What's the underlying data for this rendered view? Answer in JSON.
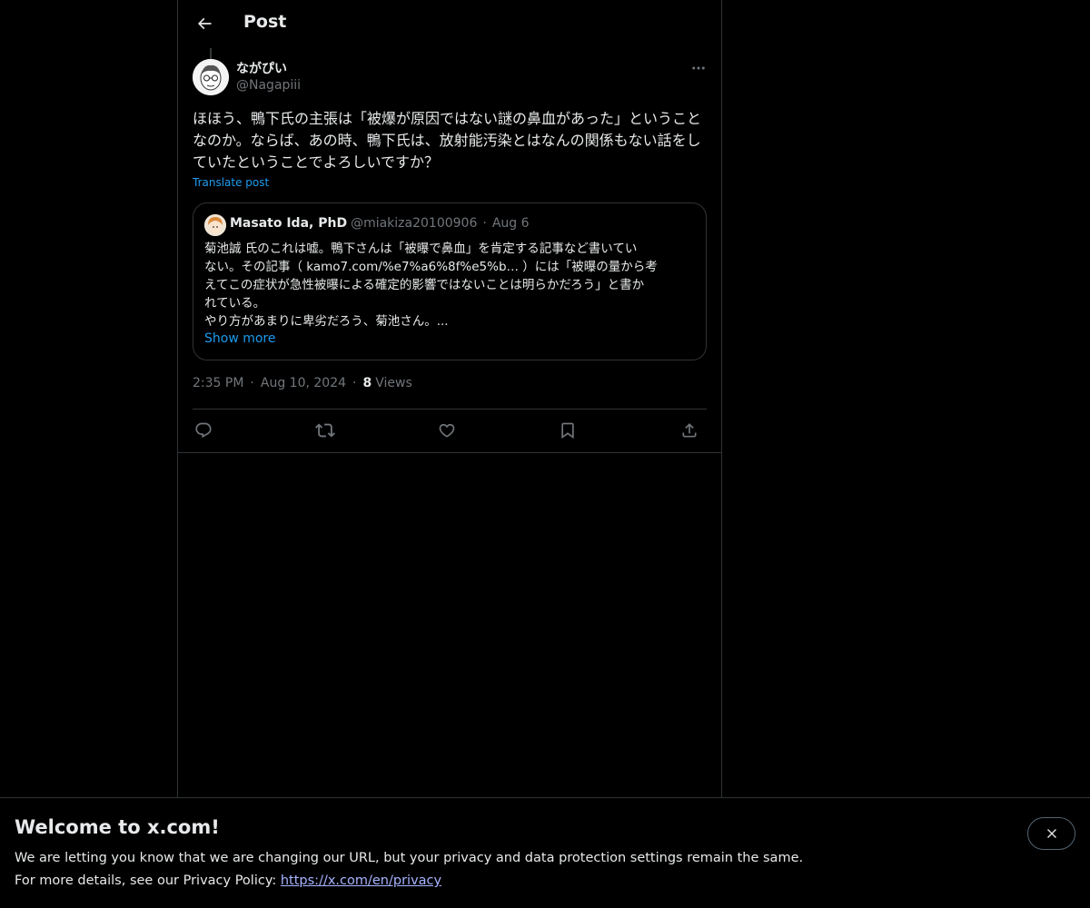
{
  "header": {
    "title": "Post"
  },
  "post": {
    "author_name": "ながぴい",
    "author_handle": "@Nagapiii",
    "text": "ほほう、鴨下氏の主張は「被爆が原因ではない謎の鼻血があった」ということなのか。ならば、あの時、鴨下氏は、放射能汚染とはなんの関係もない話をしていたということでよろしいですか？",
    "translate_label": "Translate post",
    "time": "2:35 PM",
    "date": "Aug 10, 2024",
    "views_count": "8",
    "views_label": "Views",
    "separator": "·"
  },
  "quote": {
    "name": "Masato Ida, PhD",
    "handle": "@miakiza20100906",
    "separator": "·",
    "date": "Aug 6",
    "text_lines": [
      "菊池誠 氏のこれは嘘。鴨下さんは「被曝で鼻血」を肯定する記事など書いてい",
      "ない。その記事（ kamo7.com/%e7%a6%8f%e5%b… ）には「被曝の量から考",
      "えてこの症状が急性被曝による確定的影響ではないことは明らかだろう」と書か",
      "れている。",
      "やり方があまりに卑劣だろう、菊池さん。..."
    ],
    "show_more": "Show more"
  },
  "banner": {
    "title": "Welcome to x.com!",
    "line1": "We are letting you know that we are changing our URL, but your privacy and data protection settings remain the same.",
    "line2_prefix": "For more details, see our Privacy Policy: ",
    "link": "https://x.com/en/privacy"
  },
  "icons": {
    "back": "arrow-left-icon",
    "more": "more-horizontal-icon",
    "reply": "reply-icon",
    "repost": "repost-icon",
    "like": "heart-icon",
    "bookmark": "bookmark-icon",
    "share": "share-icon",
    "close": "close-icon"
  },
  "colors": {
    "background": "#000000",
    "text": "#e7e9ea",
    "muted": "#71767b",
    "accent": "#1d9bf0",
    "border": "#2f3336",
    "link": "#a7b4ff"
  }
}
